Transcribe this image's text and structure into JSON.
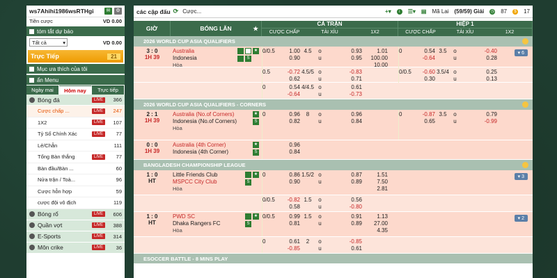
{
  "sidebar": {
    "account": "ws7Ahihi1986wsRTHgi",
    "bet_label": "Tiền cược",
    "bet_value": "VD 0.00",
    "summary_title": "tóm tắt dự báo",
    "filter_value": "Tất cả",
    "filter_amount": "VD 0.00",
    "live_label": "Trực Tiếp",
    "live_count": "21",
    "favorites": "Mục ưa thích của tôi",
    "menu_title": "ẩn Menu",
    "tabs": [
      "Ngày mai",
      "Hôm nay",
      "Trực tiếp"
    ],
    "sports": [
      {
        "name": "Bóng đá",
        "live": "LIVE",
        "count": "366"
      },
      {
        "name": "Bóng rổ",
        "live": "LIVE",
        "count": "606"
      },
      {
        "name": "Quần vợt",
        "live": "LIVE",
        "count": "388"
      },
      {
        "name": "E-Sports",
        "live": "LIVE",
        "count": "314"
      },
      {
        "name": "Môn crike",
        "live": "LIVE",
        "count": "36"
      }
    ],
    "subs": [
      {
        "name": "Cược chấp ...",
        "live": "LIVE",
        "count": "247"
      },
      {
        "name": "1X2",
        "live": "LIVE",
        "count": "107"
      },
      {
        "name": "Tỷ Số Chính Xác",
        "live": "LIVE",
        "count": "77"
      },
      {
        "name": "Lẻ/Chẵn",
        "live": "",
        "count": "111"
      },
      {
        "name": "Tổng Bàn thắng",
        "live": "LIVE",
        "count": "77"
      },
      {
        "name": "Bàn đầu/Bàn ...",
        "live": "",
        "count": "60"
      },
      {
        "name": "Nửa trận / Toà...",
        "live": "",
        "count": "96"
      },
      {
        "name": "Cược hỗn hợp",
        "live": "",
        "count": "59"
      },
      {
        "name": "cược đội vô địch",
        "live": "",
        "count": "119"
      }
    ],
    "live_color": "#c62828"
  },
  "main": {
    "title": "các cặp đấu",
    "cuoc": "Cược...",
    "region": "Mã Lai",
    "count": "(59/59) Giải",
    "stat1": "87",
    "stat2": "17",
    "headers": {
      "time": "GIỜ",
      "team": "BÓNG LĂN",
      "full": "CẢ TRẬN",
      "half": "HIỆP 1",
      "cols": [
        "CƯỢC CHẤP",
        "TÀI XỈU",
        "1X2"
      ]
    },
    "leagues": [
      "2026 WORLD CUP ASIA QUALIFIERS",
      "2026 WORLD CUP ASIA QUALIFIERS - CORNERS",
      "BANGLADESH CHAMPIONSHIP LEAGUE",
      "ESOCCER BATTLE - 8 MINS PLAY"
    ],
    "m1": {
      "score": "3 : 0",
      "time": "1H 39",
      "home": "Australia",
      "away": "Indonesia",
      "draw": "Hòa",
      "btn": "6",
      "r1": [
        "0/0.5",
        "1.00",
        "4.5",
        "o",
        "0.93",
        "1.01",
        "0",
        "0.54",
        "3.5",
        "o",
        "-0.40",
        ""
      ],
      "r1b": [
        "",
        "0.90",
        "",
        "u",
        "0.95",
        "100.00",
        "",
        "-0.64",
        "",
        "u",
        "0.28",
        ""
      ],
      "r1c": [
        "",
        "",
        "",
        "",
        "",
        "10.00",
        "",
        "",
        "",
        "",
        "",
        ""
      ],
      "r2": [
        "0.5",
        "-0.72",
        "4.5/5",
        "o",
        "-0.83",
        "",
        "0/0.5",
        "-0.60",
        "3.5/4",
        "o",
        "0.25",
        ""
      ],
      "r2b": [
        "",
        "0.62",
        "",
        "u",
        "0.71",
        "",
        "",
        "0.30",
        "",
        "u",
        "0.13",
        ""
      ],
      "r3": [
        "0",
        "0.54",
        "4/4.5",
        "o",
        "0.61",
        "",
        "",
        "",
        "",
        "",
        "",
        ""
      ],
      "r3b": [
        "",
        "-0.64",
        "",
        "u",
        "-0.73",
        "",
        "",
        "",
        "",
        "",
        "",
        ""
      ]
    },
    "m2": {
      "score": "2 : 1",
      "time": "1H 39",
      "home": "Australia (No.of Corners)",
      "away": "Indonesia (No.of Corners)",
      "draw": "Hòa",
      "r1": [
        "0",
        "0.96",
        "8",
        "o",
        "0.96",
        "",
        "",
        "-0.87",
        "3.5",
        "o",
        "0.79",
        ""
      ],
      "r1b": [
        "",
        "0.82",
        "",
        "u",
        "0.84",
        "",
        "0",
        "0.65",
        "",
        "u",
        "-0.99",
        ""
      ]
    },
    "m3": {
      "score": "0 : 0",
      "time": "1H 39",
      "home": "Australia (4th Corner)",
      "away": "Indonesia (4th Corner)",
      "r1": [
        "",
        "0.96"
      ],
      "r1b": [
        "",
        "0.84"
      ]
    },
    "m4": {
      "score": "1 : 0",
      "time": "HT",
      "home": "Little Friends Club",
      "away": "MSPCC City Club",
      "draw": "Hòa",
      "btn": "3",
      "r1": [
        "0",
        "0.86",
        "1.5/2",
        "o",
        "0.87",
        "1.51"
      ],
      "r1b": [
        "",
        "0.90",
        "",
        "u",
        "0.89",
        "7.50"
      ],
      "r1c": [
        "",
        "",
        "",
        "",
        "",
        "2.81"
      ],
      "r2": [
        "",
        "-0.82",
        "1.5",
        "o",
        "0.56",
        ""
      ],
      "r2b": [
        "0/0.5",
        "0.58",
        "",
        "u",
        "-0.80",
        ""
      ]
    },
    "m5": {
      "score": "1 : 0",
      "time": "HT",
      "home": "PWD SC",
      "away": "Dhaka Rangers FC",
      "draw": "Hòa",
      "btn": "2",
      "r1": [
        "0/0.5",
        "0.99",
        "1.5",
        "o",
        "0.91",
        "1.13"
      ],
      "r1b": [
        "",
        "0.81",
        "",
        "u",
        "0.89",
        "27.00"
      ],
      "r1c": [
        "",
        "",
        "",
        "",
        "",
        "4.35"
      ],
      "r2": [
        "0",
        "0.61",
        "2",
        "o",
        "-0.85",
        ""
      ],
      "r2b": [
        "",
        "-0.85",
        "",
        "u",
        "0.61",
        ""
      ]
    }
  }
}
